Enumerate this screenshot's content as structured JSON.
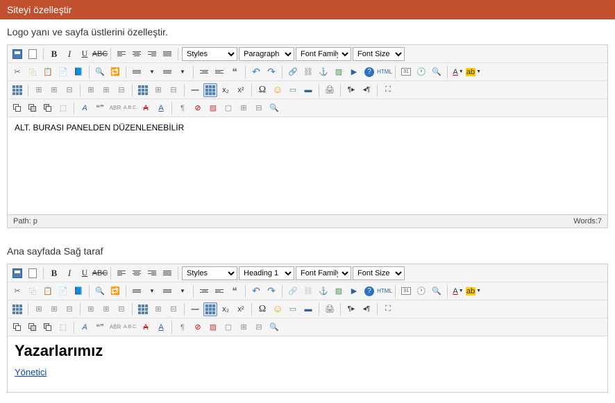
{
  "header": {
    "title": "Siteyi özelleştir"
  },
  "section1": {
    "label": "Logo yanı ve sayfa üstlerini özelleştir."
  },
  "section2": {
    "label": "Ana sayfada Sağ taraf"
  },
  "editor1": {
    "selects": {
      "styles": "Styles",
      "format": "Paragraph",
      "fontfamily": "Font Family",
      "fontsize": "Font Size"
    },
    "content": "ALT. BURASI PANELDEN DÜZENLENEBİLİR",
    "status": {
      "path": "Path: p",
      "words": "Words:7"
    }
  },
  "editor2": {
    "selects": {
      "styles": "Styles",
      "format": "Heading 1",
      "fontfamily": "Font Family",
      "fontsize": "Font Size"
    },
    "heading": "Yazarlarımız",
    "link": "Yönetici"
  },
  "icons": {
    "save": "save",
    "new": "new",
    "bold": "B",
    "italic": "I",
    "underline": "U",
    "strike": "ABC",
    "cut": "✂",
    "copy": "⿻",
    "paste": "📋",
    "pastetext": "📋",
    "pasteword": "📋",
    "find": "🔍",
    "replace": "🔁",
    "ul": "•",
    "ol": "1.",
    "outdent": "⇤",
    "indent": "⇥",
    "quote": "❝",
    "undo": "↶",
    "redo": "↷",
    "link": "🔗",
    "unlink": "⛓",
    "anchor": "⚓",
    "img": "▦",
    "media": "▶",
    "help": "?",
    "html": "HTML",
    "date": "📅",
    "time": "🕐",
    "preview": "🔍",
    "search": "🔎",
    "textcolor": "A",
    "bgcolor": "ab",
    "table": "",
    "trow": "",
    "tcol": "",
    "hr": "–",
    "sub": "x₂",
    "sup": "x²",
    "omega": "Ω",
    "smiley": "☺",
    "pagebreak": "▭",
    "template": "—",
    "print": "🖨",
    "ltr": "¶▸",
    "rtl": "◂¶",
    "fullscreen": "⛶",
    "layer1": "",
    "layer2": "",
    "layer3": "",
    "div": "",
    "style1": "Aa",
    "style2": "ABC",
    "style3": "A.B.C.",
    "style4": "A",
    "pilcrow": "¶",
    "cancel": "⊘",
    "img2": "▦",
    "clip": "✂",
    "scale": "⊞",
    "zoom": "🔍"
  }
}
